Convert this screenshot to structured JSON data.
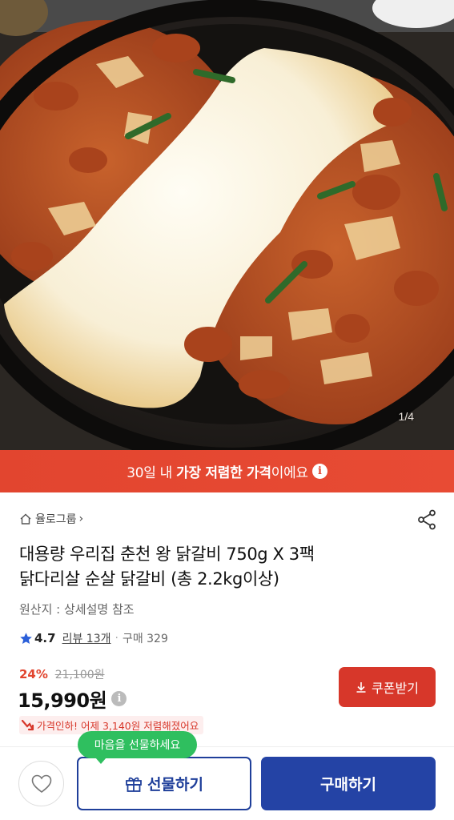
{
  "hero": {
    "image_counter": "1/4"
  },
  "promo": {
    "prefix": "30일 내 ",
    "highlight": "가장 저렴한 가격",
    "suffix": "이에요",
    "info_icon": "info-icon"
  },
  "product": {
    "brand": "율로그룹",
    "title_line1": "대용량 우리집 춘천 왕 닭갈비 750g X 3팩",
    "title_line2": "닭다리살 순살 닭갈비 (총 2.2kg이상)",
    "origin": "원산지 : 상세설명 참조",
    "rating": "4.7",
    "review_label": "리뷰 13개",
    "purchase_label": "구매 329",
    "discount_pct": "24%",
    "original_price": "21,100원",
    "price": "15,990원",
    "coupon_label": "쿠폰받기",
    "price_drop": "가격인하! 어제 3,140원 저렴해졌어요"
  },
  "bottom_bar": {
    "tooltip": "마음을 선물하세요",
    "gift_label": "선물하기",
    "buy_label": "구매하기"
  },
  "colors": {
    "promo_red": "#e2452f",
    "coupon_red": "#d7372a",
    "primary_blue": "#2443a5",
    "tooltip_green": "#2fbf5f",
    "rating_star": "#2b5fd9"
  },
  "icons": [
    "home-icon",
    "chevron-right-icon",
    "share-icon",
    "star-icon",
    "info-icon",
    "download-icon",
    "price-drop-icon",
    "heart-icon",
    "gift-icon"
  ]
}
